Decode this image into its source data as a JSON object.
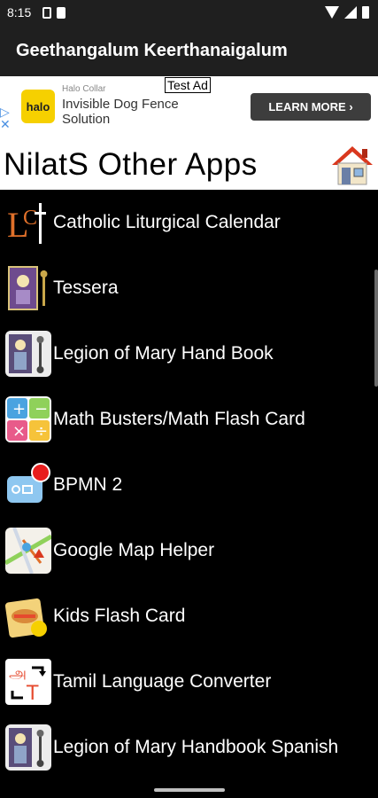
{
  "status": {
    "time": "8:15"
  },
  "app_bar": {
    "title": "Geethangalum Keerthanaigalum"
  },
  "ad": {
    "label": "Test Ad",
    "logo_text": "halo",
    "brand": "Halo Collar",
    "line1": "Invisible Dog Fence",
    "line2": "Solution",
    "cta": "LEARN MORE ›"
  },
  "header": {
    "title": "NilatS Other Apps"
  },
  "apps": [
    {
      "label": "Catholic Liturgical Calendar",
      "icon": "lc-calendar-icon"
    },
    {
      "label": "Tessera",
      "icon": "tessera-icon"
    },
    {
      "label": "Legion of Mary Hand Book",
      "icon": "legion-of-mary-icon"
    },
    {
      "label": "Math Busters/Math Flash Card",
      "icon": "math-icon"
    },
    {
      "label": "BPMN 2",
      "icon": "bpmn-icon"
    },
    {
      "label": "Google Map Helper",
      "icon": "map-icon"
    },
    {
      "label": "Kids Flash Card",
      "icon": "kids-flash-card-icon"
    },
    {
      "label": "Tamil Language Converter",
      "icon": "tamil-converter-icon"
    },
    {
      "label": "Legion of Mary Handbook Spanish",
      "icon": "legion-of-mary-spanish-icon"
    }
  ]
}
